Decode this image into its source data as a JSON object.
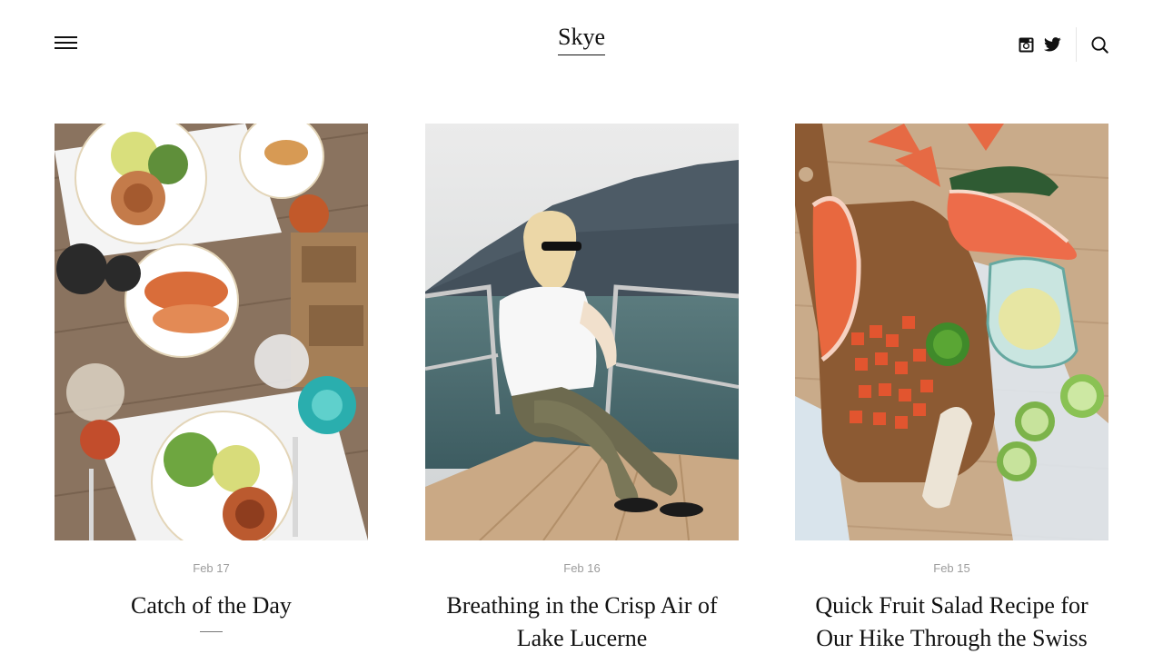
{
  "header": {
    "logo": "Skye",
    "menu_icon": "hamburger-menu-icon",
    "social_icons": [
      "instagram-icon",
      "twitter-icon"
    ],
    "search_icon": "search-icon"
  },
  "posts": [
    {
      "date": "Feb 17",
      "title": "Catch of the Day"
    },
    {
      "date": "Feb 16",
      "title": "Breathing in the Crisp Air of Lake Lucerne"
    },
    {
      "date": "Feb 15",
      "title": "Quick Fruit Salad Recipe for Our Hike Through the Swiss"
    }
  ],
  "colors": {
    "text": "#111111",
    "meta": "#9c9c9c",
    "divider": "#e6e6e6"
  }
}
